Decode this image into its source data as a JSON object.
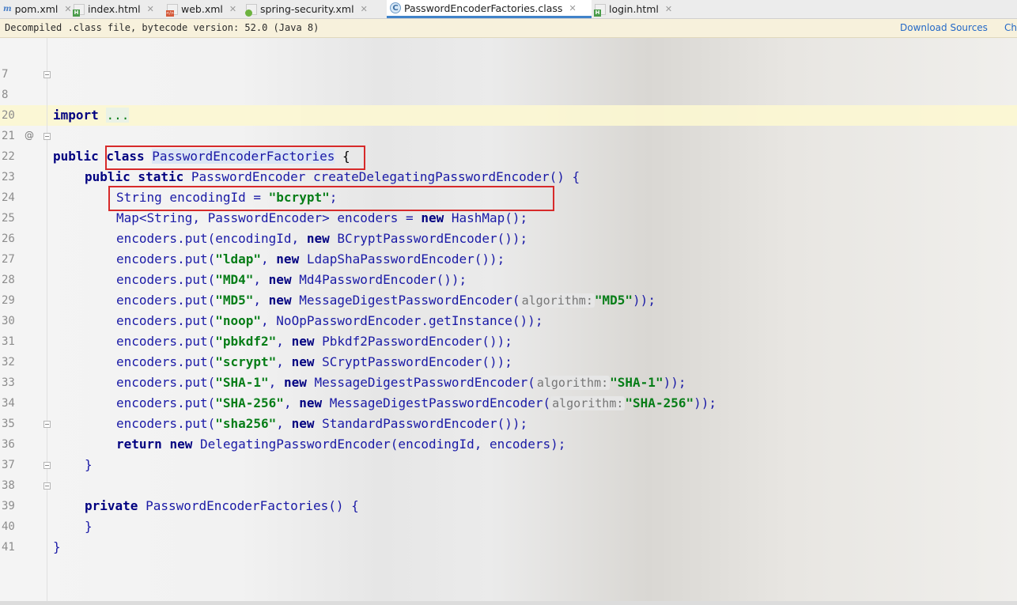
{
  "tabs": [
    {
      "label": "pom.xml",
      "icon": "maven-icon",
      "active": false
    },
    {
      "label": "index.html",
      "icon": "html-file-icon",
      "active": false
    },
    {
      "label": "web.xml",
      "icon": "xml-file-icon",
      "active": false
    },
    {
      "label": "spring-security.xml",
      "icon": "spring-xml-icon",
      "active": false
    },
    {
      "label": "PasswordEncoderFactories.class",
      "icon": "java-class-icon",
      "active": true
    },
    {
      "label": "login.html",
      "icon": "html-file-icon",
      "active": false
    }
  ],
  "banner": {
    "text": "Decompiled .class file, bytecode version: 52.0 (Java 8)",
    "download_link": "Download Sources",
    "choose_link": "Che"
  },
  "editor": {
    "line_numbers": [
      "7",
      "8",
      "20",
      "21",
      "22",
      "23",
      "24",
      "25",
      "26",
      "27",
      "28",
      "29",
      "30",
      "31",
      "32",
      "33",
      "34",
      "35",
      "36",
      "37",
      "38",
      "39",
      "40",
      "41"
    ],
    "hint_label": "algorithm:",
    "code": {
      "l8_kw": "import",
      "l8_fold": "...",
      "l21_kw": "public class",
      "l21_cls": "PasswordEncoderFactories",
      "l21_rest": " {",
      "l22_kw": "public static",
      "l22_rest": " PasswordEncoder createDelegatingPasswordEncoder() {",
      "l23_a": "String encodingId = ",
      "l23_str": "\"bcrypt\"",
      "l23_b": ";",
      "l24_a": "Map<String, PasswordEncoder> encoders = ",
      "l24_kw": "new",
      "l24_b": " HashMap();",
      "l25_a": "encoders.put(encodingId, ",
      "l25_kw": "new",
      "l25_b": " BCryptPasswordEncoder());",
      "l26_a": "encoders.put(",
      "l26_str": "\"ldap\"",
      "l26_kw": "new",
      "l26_b": " LdapShaPasswordEncoder());",
      "l27_a": "encoders.put(",
      "l27_str": "\"MD4\"",
      "l27_kw": "new",
      "l27_b": " Md4PasswordEncoder());",
      "l28_a": "encoders.put(",
      "l28_str": "\"MD5\"",
      "l28_kw": "new",
      "l28_b": " MessageDigestPasswordEncoder(",
      "l28_arg": "\"MD5\"",
      "l28_c": "));",
      "l29_a": "encoders.put(",
      "l29_str": "\"noop\"",
      "l29_b": ", NoOpPasswordEncoder.getInstance());",
      "l30_a": "encoders.put(",
      "l30_str": "\"pbkdf2\"",
      "l30_kw": "new",
      "l30_b": " Pbkdf2PasswordEncoder());",
      "l31_a": "encoders.put(",
      "l31_str": "\"scrypt\"",
      "l31_kw": "new",
      "l31_b": " SCryptPasswordEncoder());",
      "l32_a": "encoders.put(",
      "l32_str": "\"SHA-1\"",
      "l32_kw": "new",
      "l32_b": " MessageDigestPasswordEncoder(",
      "l32_arg": "\"SHA-1\"",
      "l32_c": "));",
      "l33_a": "encoders.put(",
      "l33_str": "\"SHA-256\"",
      "l33_kw": "new",
      "l33_b": " MessageDigestPasswordEncoder(",
      "l33_arg": "\"SHA-256\"",
      "l33_c": "));",
      "l34_a": "encoders.put(",
      "l34_str": "\"sha256\"",
      "l34_kw": "new",
      "l34_b": " StandardPasswordEncoder());",
      "l35_kw1": "return",
      "l35_kw2": "new",
      "l35_b": " DelegatingPasswordEncoder(encodingId, encoders);",
      "close_brace": "}",
      "l38_kw": "private",
      "l38_b": " PasswordEncoderFactories() {"
    }
  }
}
